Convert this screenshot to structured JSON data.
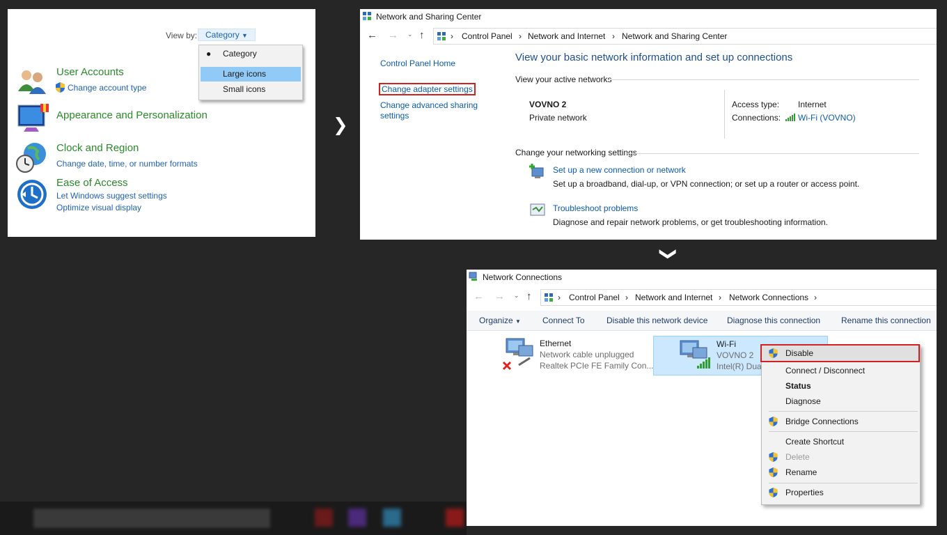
{
  "panel1": {
    "view_by_label": "View by:",
    "view_by_value": "Category",
    "dropdown": [
      "Category",
      "Large icons",
      "Small icons"
    ],
    "dropdown_selected_index": 0,
    "dropdown_highlight_index": 1,
    "categories": [
      {
        "title": "User Accounts",
        "links": [
          "Change account type"
        ]
      },
      {
        "title": "Appearance and Personalization",
        "links": []
      },
      {
        "title": "Clock and Region",
        "links": [
          "Change date, time, or number formats"
        ]
      },
      {
        "title": "Ease of Access",
        "links": [
          "Let Windows suggest settings",
          "Optimize visual display"
        ]
      }
    ]
  },
  "panel2": {
    "window_title": "Network and Sharing Center",
    "breadcrumb": [
      "Control Panel",
      "Network and Internet",
      "Network and Sharing Center"
    ],
    "sidebar": [
      "Control Panel Home",
      "Change adapter settings",
      "Change advanced sharing",
      "settings"
    ],
    "heading": "View your basic network information and set up connections",
    "active_networks_label": "View your active networks",
    "network_name": "VOVNO  2",
    "network_type": "Private network",
    "access_type_label": "Access type:",
    "access_type_value": "Internet",
    "connections_label": "Connections:",
    "connections_value": "Wi-Fi (VOVNO)",
    "change_settings_label": "Change your networking settings",
    "actions": [
      {
        "link": "Set up a new connection or network",
        "desc": "Set up a broadband, dial-up, or VPN connection; or set up a router or access point."
      },
      {
        "link": "Troubleshoot problems",
        "desc": "Diagnose and repair network problems, or get troubleshooting information."
      }
    ]
  },
  "panel3": {
    "window_title": "Network Connections",
    "breadcrumb": [
      "Control Panel",
      "Network and Internet",
      "Network Connections"
    ],
    "commands": [
      "Organize",
      "Connect To",
      "Disable this network device",
      "Diagnose this connection",
      "Rename this connection"
    ],
    "adapters": [
      {
        "name": "Ethernet",
        "status": "Network cable unplugged",
        "device": "Realtek PCIe FE Family Con..."
      },
      {
        "name": "Wi-Fi",
        "status": "VOVNO  2",
        "device": "Intel(R) Dual"
      }
    ],
    "context_menu": [
      "Disable",
      "Connect / Disconnect",
      "Status",
      "Diagnose",
      "Bridge Connections",
      "Create Shortcut",
      "Delete",
      "Rename",
      "Properties"
    ]
  },
  "colors": {
    "highlight": "#d21f1f",
    "link": "#0b5cad",
    "category": "#2a8a2a",
    "selection": "#91c9f7"
  }
}
